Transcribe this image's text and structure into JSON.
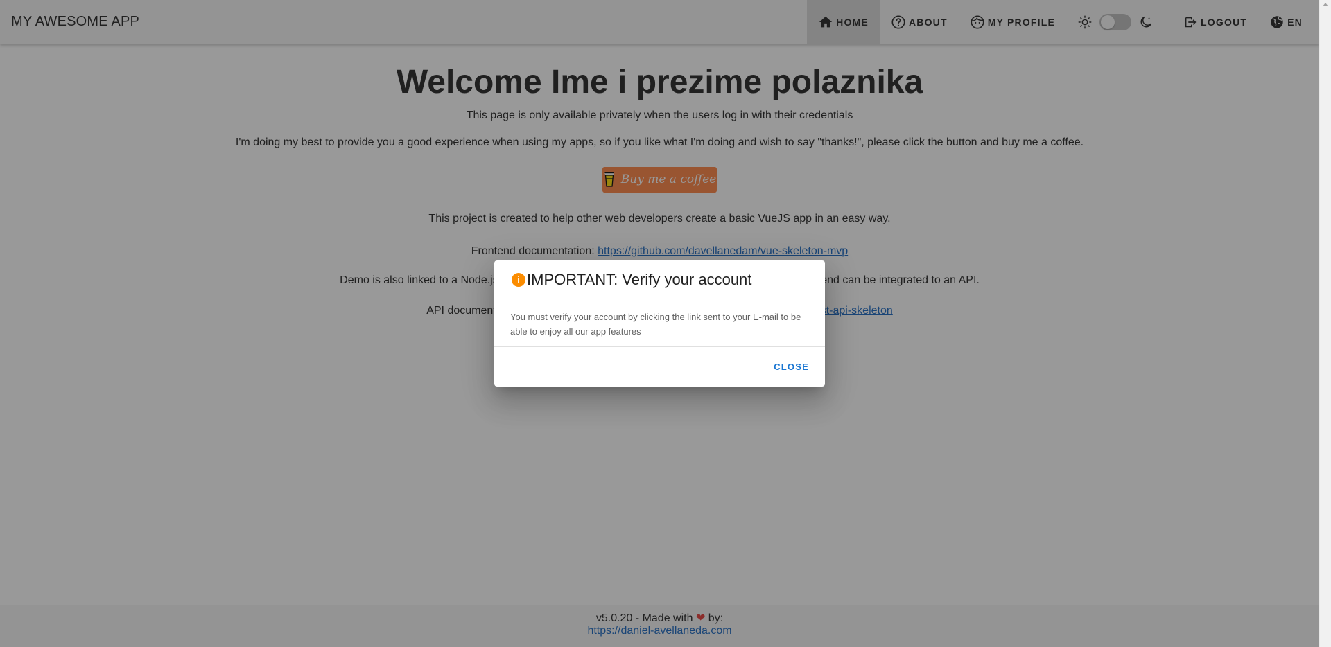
{
  "appbar": {
    "title": "MY AWESOME APP",
    "nav": {
      "home": "HOME",
      "about": "ABOUT",
      "profile": "MY PROFILE",
      "logout": "LOGOUT",
      "language": "EN"
    }
  },
  "main": {
    "heading": "Welcome Ime i prezime polaznika",
    "subtitle": "This page is only available privately when the users log in with their credentials",
    "thanks": "I'm doing my best to provide you a good experience when using my apps, so if you like what I'm doing and wish to say \"thanks!\", please click the button and buy me a coffee.",
    "coffee_button": "Buy me a coffee",
    "project_note": "This project is created to help other web developers create a basic VueJS app in an easy way.",
    "frontend_label": "Frontend documentation: ",
    "frontend_link": "https://github.com/davellanedam/vue-skeleton-mvp",
    "demo_before": "Demo is also linked to a Node.js ex",
    "demo_after": "how this frontend can be integrated to an API.",
    "api_label": "API documentatio",
    "api_link_tail": "rest-api-skeleton"
  },
  "footer": {
    "text_before": "v5.0.20 - Made with ",
    "text_after": " by:",
    "link": "https://daniel-avellaneda.com"
  },
  "dialog": {
    "title": "IMPORTANT: Verify your account",
    "body": "You must verify your account by clicking the link sent to your E-mail to be able to enjoy all our app features",
    "close": "CLOSE"
  },
  "colors": {
    "coffee_button": "#ff813f",
    "link": "#1565c0",
    "info_icon": "#fb8c00",
    "close_button": "#1976d2"
  }
}
